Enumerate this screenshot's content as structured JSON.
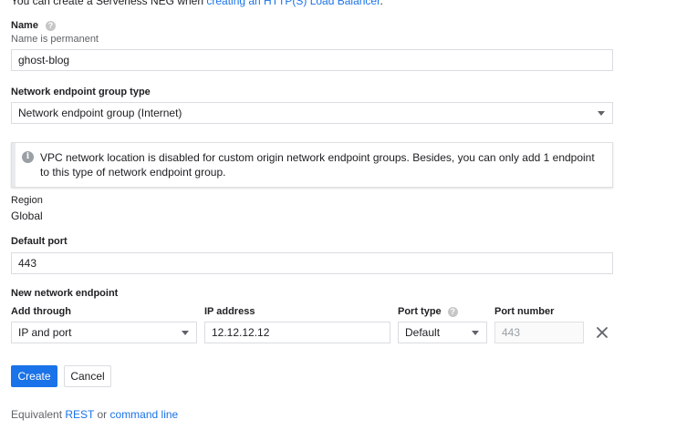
{
  "intro": {
    "text": "You can create a Serverless NEG when ",
    "link": "creating an HTTP(S) Load Balancer",
    "suffix": "."
  },
  "name": {
    "label": "Name",
    "sublabel": "Name is permanent",
    "value": "ghost-blog",
    "help_icon": "help-icon"
  },
  "neg_type": {
    "label": "Network endpoint group type",
    "value": "Network endpoint group (Internet)"
  },
  "info": {
    "icon": "info-icon",
    "line1": "VPC network location is disabled for custom origin network endpoint groups. Besides, you can only add 1 endpoint",
    "line2": "to this type of network endpoint group."
  },
  "region": {
    "label": "Region",
    "value": "Global"
  },
  "default_port": {
    "label": "Default port",
    "value": "443"
  },
  "new_endpoint": {
    "label": "New network endpoint",
    "add_through": {
      "label": "Add through",
      "value": "IP and port"
    },
    "ip_address": {
      "label": "IP address",
      "value": "12.12.12.12"
    },
    "port_type": {
      "label": "Port type",
      "value": "Default"
    },
    "port_number": {
      "label": "Port number",
      "placeholder": "443"
    },
    "remove_icon": "close-icon"
  },
  "actions": {
    "create": "Create",
    "cancel": "Cancel"
  },
  "footer": {
    "prefix": "Equivalent ",
    "rest": "REST",
    "or": " or ",
    "cli": "command line"
  },
  "colors": {
    "accent": "#1a73e8",
    "border": "#dadce0",
    "text": "#202124",
    "muted": "#5f6368"
  }
}
